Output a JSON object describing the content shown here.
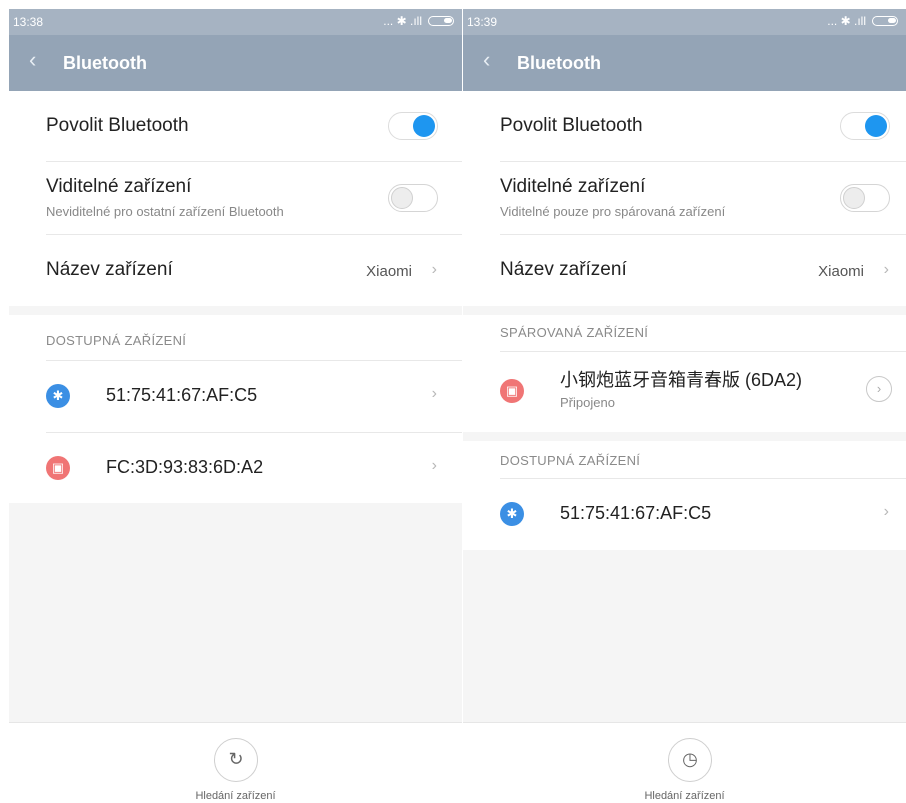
{
  "left": {
    "status": {
      "time": "13:38",
      "icons": "... ✱ .ıll"
    },
    "title": "Bluetooth",
    "enable_label": "Povolit Bluetooth",
    "visible_label": "Viditelné zařízení",
    "visible_sub": "Neviditelné pro ostatní zařízení Bluetooth",
    "name_label": "Název zařízení",
    "name_value": "Xiaomi",
    "available_header": "DOSTUPNÁ ZAŘÍZENÍ",
    "devices": [
      {
        "name": "51:75:41:67:AF:C5",
        "icon": "bluetooth-icon"
      },
      {
        "name": "FC:3D:93:83:6D:A2",
        "icon": "speaker-icon"
      }
    ],
    "scan_label": "Hledání zařízení"
  },
  "right": {
    "status": {
      "time": "13:39",
      "icons": "... ✱ .ıll"
    },
    "title": "Bluetooth",
    "enable_label": "Povolit Bluetooth",
    "visible_label": "Viditelné zařízení",
    "visible_sub": "Viditelné pouze pro spárovaná zařízení",
    "name_label": "Název zařízení",
    "name_value": "Xiaomi",
    "paired_header": "SPÁROVANÁ ZAŘÍZENÍ",
    "paired_device": {
      "name": "小钢炮蓝牙音箱青春版 (6DA2)",
      "status": "Připojeno",
      "icon": "speaker-icon"
    },
    "available_header": "DOSTUPNÁ ZAŘÍZENÍ",
    "devices": [
      {
        "name": "51:75:41:67:AF:C5",
        "icon": "bluetooth-icon"
      }
    ],
    "scan_label": "Hledání zařízení"
  },
  "colors": {
    "accent": "#1e96f0",
    "titlebar": "#94a4b6",
    "bt_icon": "#3b8fe4",
    "speaker_icon": "#f07575"
  }
}
